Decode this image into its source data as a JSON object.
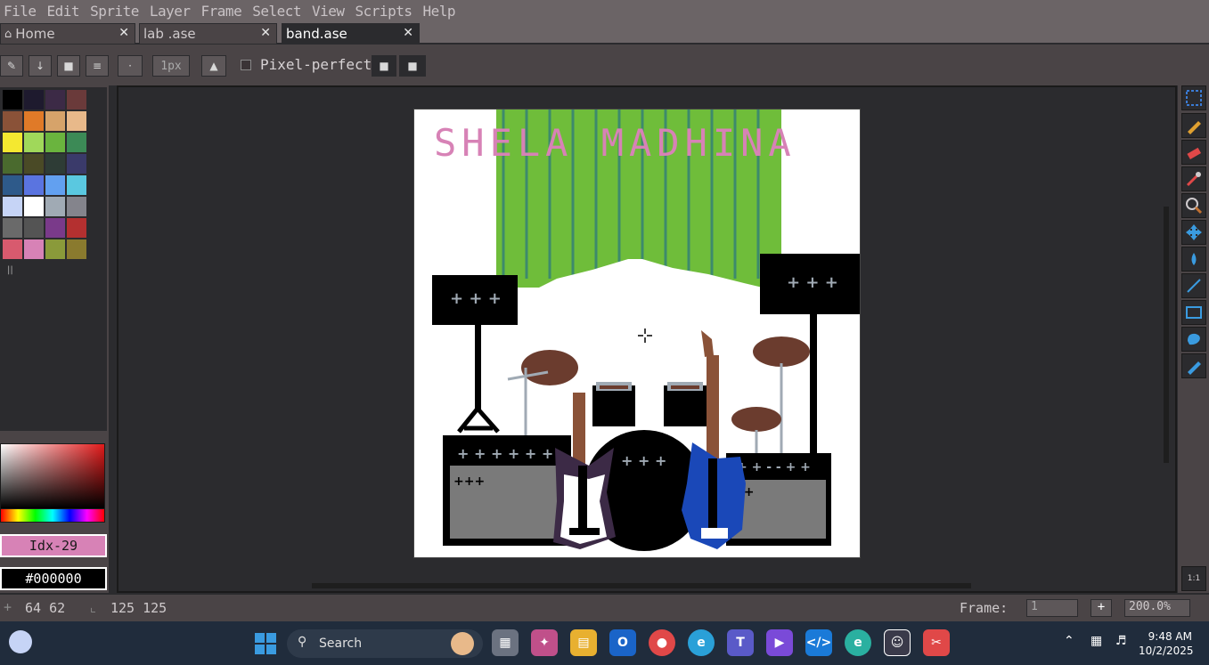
{
  "menu": [
    "File",
    "Edit",
    "Sprite",
    "Layer",
    "Frame",
    "Select",
    "View",
    "Scripts",
    "Help"
  ],
  "tabs": [
    {
      "label": "Home"
    },
    {
      "label": "lab .ase"
    },
    {
      "label": "band.ase"
    }
  ],
  "toolbar": {
    "brush_size": "1px",
    "pixel_perfect_label": "Pixel-perfect",
    "pixel_perfect_checked": false
  },
  "palette": {
    "colors": [
      "#000000",
      "#1e1a2e",
      "#3c2a46",
      "#6a3a3a",
      "#8a5238",
      "#e07a28",
      "#d6a36a",
      "#e8b98a",
      "#f4e830",
      "#a0d85a",
      "#6ab43e",
      "#3c8a56",
      "#4a6a2e",
      "#4a4a26",
      "#2e3c36",
      "#3a3a6a",
      "#2e5a8a",
      "#5a74e0",
      "#62a0f0",
      "#5ac8e0",
      "#c6d4f6",
      "#ffffff",
      "#a0aab4",
      "#84848c",
      "#6a6a6a",
      "#545454",
      "#7a3a8a",
      "#b43030",
      "#d85a6e",
      "#d782b6",
      "#8a9a3a",
      "#8a7a2e"
    ]
  },
  "color": {
    "index_label": "Idx-29",
    "hex_label": "#000000",
    "accent": "#d782b6"
  },
  "canvas": {
    "title_text": "SHELA MADHINA",
    "title_color": "#d782b6",
    "curtain_color": "#6fbd3a",
    "curtain_stripe_color": "#3d8a6c"
  },
  "tools": [
    "marquee-icon",
    "pencil-icon",
    "eraser-icon",
    "eyedropper-icon",
    "zoom-icon",
    "move-icon",
    "paint-bucket-icon",
    "line-icon",
    "rectangle-icon",
    "lasso-icon",
    "blur-icon"
  ],
  "status": {
    "cursor_pos": "64 62",
    "sprite_size": "125 125",
    "frame_label": "Frame:",
    "frame_value": "1",
    "zoom": "200.0%",
    "zoom_reset": "1:1"
  },
  "taskbar": {
    "search_placeholder": "Search",
    "time": "9:48 AM",
    "date": "10/2/2025"
  }
}
